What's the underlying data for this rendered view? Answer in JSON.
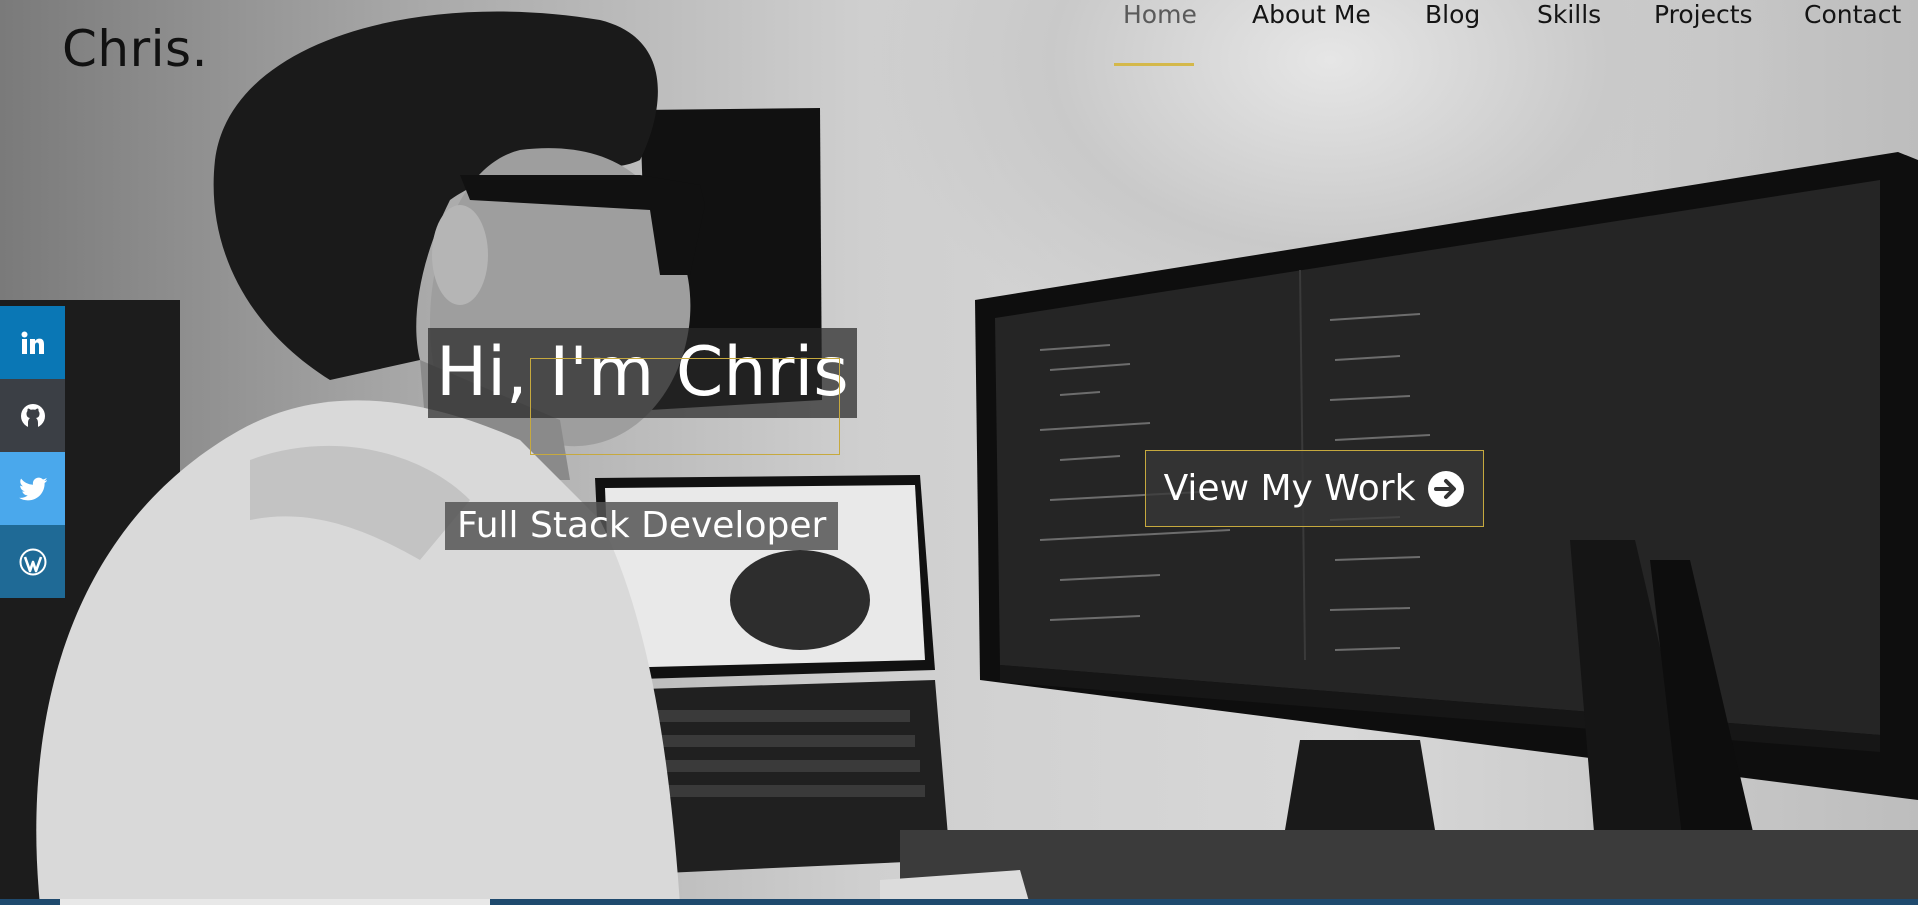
{
  "header": {
    "logo": "Chris.",
    "nav": [
      {
        "label": "Home",
        "active": true
      },
      {
        "label": "About Me",
        "active": false
      },
      {
        "label": "Blog",
        "active": false
      },
      {
        "label": "Skills",
        "active": false
      },
      {
        "label": "Projects",
        "active": false
      },
      {
        "label": "Contact",
        "active": false
      }
    ],
    "active_underline_color": "#d4b84a"
  },
  "social": [
    {
      "name": "linkedin",
      "icon": "linkedin-icon",
      "color": "#0a77b5"
    },
    {
      "name": "github",
      "icon": "github-icon",
      "color": "#3b3f45"
    },
    {
      "name": "twitter",
      "icon": "twitter-icon",
      "color": "#4aa8ec"
    },
    {
      "name": "wordpress",
      "icon": "wordpress-icon",
      "color": "#1f6a96"
    }
  ],
  "hero": {
    "title": "Hi, I'm Chris",
    "subtitle": "Full Stack Developer",
    "cta_label": "View My Work",
    "cta_icon": "arrow-circle-right-icon",
    "accent_color": "#c6a93e"
  }
}
